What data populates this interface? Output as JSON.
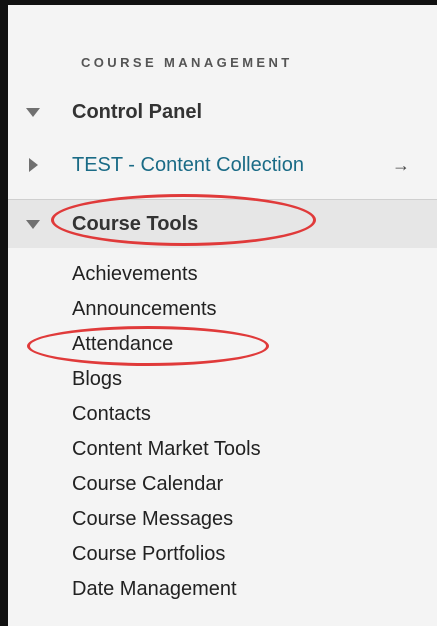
{
  "panel": {
    "section_title": "COURSE MANAGEMENT",
    "rows": {
      "control_panel": {
        "label": "Control Panel",
        "icon": "triangle-down-icon"
      },
      "content_collection": {
        "label": "TEST - Content Collection",
        "icon": "triangle-right-icon",
        "arrow": "→"
      },
      "course_tools": {
        "label": "Course Tools",
        "icon": "triangle-down-icon"
      }
    },
    "course_tools_items": [
      "Achievements",
      "Announcements",
      "Attendance",
      "Blogs",
      "Contacts",
      "Content Market Tools",
      "Course Calendar",
      "Course Messages",
      "Course Portfolios",
      "Date Management"
    ],
    "colors": {
      "link": "#1a6b86",
      "annotation": "#e03a3a",
      "panel_bg": "#f4f4f4",
      "selected_bg": "#e6e6e6"
    }
  }
}
